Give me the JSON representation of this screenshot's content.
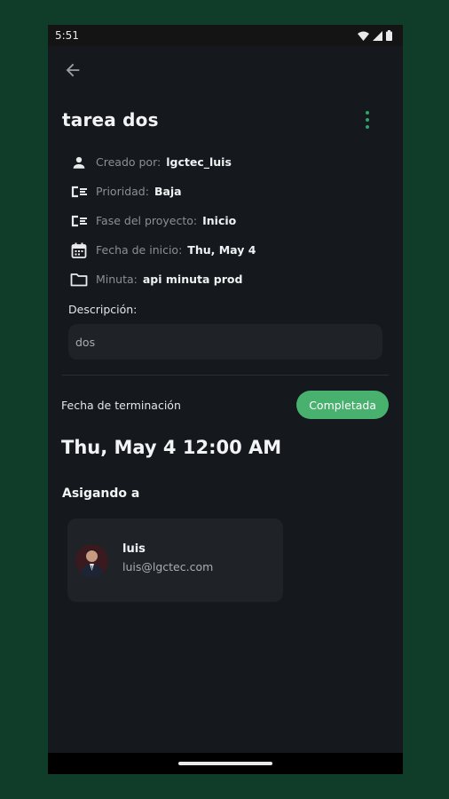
{
  "status_bar": {
    "time": "5:51"
  },
  "task": {
    "title": "tarea dos"
  },
  "details": [
    {
      "icon": "person-icon",
      "label": "Creado por:",
      "value": "lgctec_luis"
    },
    {
      "icon": "priority-icon",
      "label": "Prioridad:",
      "value": "Baja"
    },
    {
      "icon": "phase-icon",
      "label": "Fase del proyecto:",
      "value": "Inicio"
    },
    {
      "icon": "calendar-icon",
      "label": "Fecha de inicio:",
      "value": "Thu, May 4"
    },
    {
      "icon": "folder-icon",
      "label": "Minuta:",
      "value": "api minuta prod"
    }
  ],
  "description": {
    "label": "Descripción:",
    "value": "dos"
  },
  "completion": {
    "label": "Fecha de terminación",
    "status": "Completada",
    "date": "Thu, May 4 12:00 AM"
  },
  "assigned": {
    "title": "Asigando a",
    "users": [
      {
        "name": "luis",
        "email": "luis@lgctec.com"
      }
    ]
  },
  "colors": {
    "background": "#0f3d2a",
    "surface": "#15181c",
    "card": "#1f2328",
    "accent": "#49b16e"
  }
}
